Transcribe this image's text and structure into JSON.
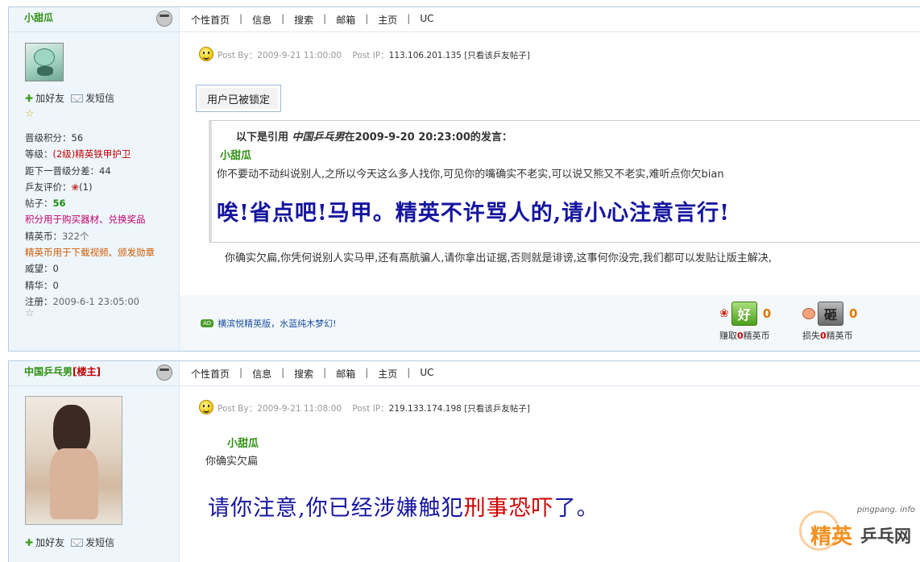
{
  "nav": [
    "个性首页",
    "信息",
    "搜索",
    "邮箱",
    "主页",
    "UC"
  ],
  "post1": {
    "username": "小甜瓜",
    "actions": {
      "add_friend": "加好友",
      "send_msg": "发短信"
    },
    "info": [
      {
        "label": "晋级积分：",
        "value": "56"
      },
      {
        "label": "等级：",
        "value": "(2级)精英铁甲护卫"
      },
      {
        "label": "距下一晋级分差：",
        "value": "44"
      },
      {
        "label": "乒友评价：",
        "value": "(1)"
      },
      {
        "label": "帖子：",
        "value": "56"
      },
      {
        "label": "",
        "value": "积分用于购买器材、兑换奖品"
      },
      {
        "label": "精英币：",
        "value": "322个"
      },
      {
        "label": "",
        "value": "精英币用于下载视频、颁发勋章"
      },
      {
        "label": "威望：",
        "value": "0"
      },
      {
        "label": "精华：",
        "value": "0"
      },
      {
        "label": "注册：",
        "value": "2009-6-1 23:05:00"
      }
    ],
    "meta": {
      "post_by": "Post By：2009-9-21 11:00:00",
      "post_ip_label": "Post IP：",
      "post_ip": "113.106.201.135",
      "only_view": "[只看该乒友帖子]"
    },
    "locked": "用户已被锁定",
    "quote": {
      "head_prefix": "以下是引用",
      "head_user": "中国乒乓男",
      "head_suffix": "在2009-9-20 20:23:00的发言：",
      "name": "小甜瓜",
      "text": "你不要动不动纠说别人,之所以今天这么多人找你,可见你的嘴确实不老实,可以说又熊又不老实,难听点你欠bian",
      "big": "唉!省点吧!马甲。精英不许骂人的,请小心注意言行!"
    },
    "body": "你确实欠扁,你凭何说别人实马甲,还有高航骗人,请你拿出证据,否则就是诽谤,这事何你没完,我们都可以发贴让版主解决,",
    "ad": {
      "badge": "AD",
      "text": "横滨悦精英版，水蓝纯木梦幻!"
    },
    "good": {
      "btn": "好",
      "count": "0",
      "desc_pre": "赚取",
      "desc_num": "0",
      "desc_post": "精英币"
    },
    "bad": {
      "btn": "砸",
      "count": "0",
      "desc_pre": "损失",
      "desc_num": "0",
      "desc_post": "精英币"
    }
  },
  "post2": {
    "username": "中国乒乓男",
    "role": "[楼主]",
    "actions": {
      "add_friend": "加好友",
      "send_msg": "发短信"
    },
    "meta": {
      "post_by": "Post By：2009-9-21 11:08:00",
      "post_ip_label": "Post IP：",
      "post_ip": "219.133.174.198",
      "only_view": "[只看该乒友帖子]"
    },
    "name": "小甜瓜",
    "text": "你确实欠扁",
    "big_blue": "请你注意,你已经涉嫌触犯",
    "big_red": "刑事恐吓",
    "big_end": "了。"
  },
  "watermark": {
    "url": "pingpang. info",
    "brand1": "精英",
    "brand2": "乒乓网"
  }
}
